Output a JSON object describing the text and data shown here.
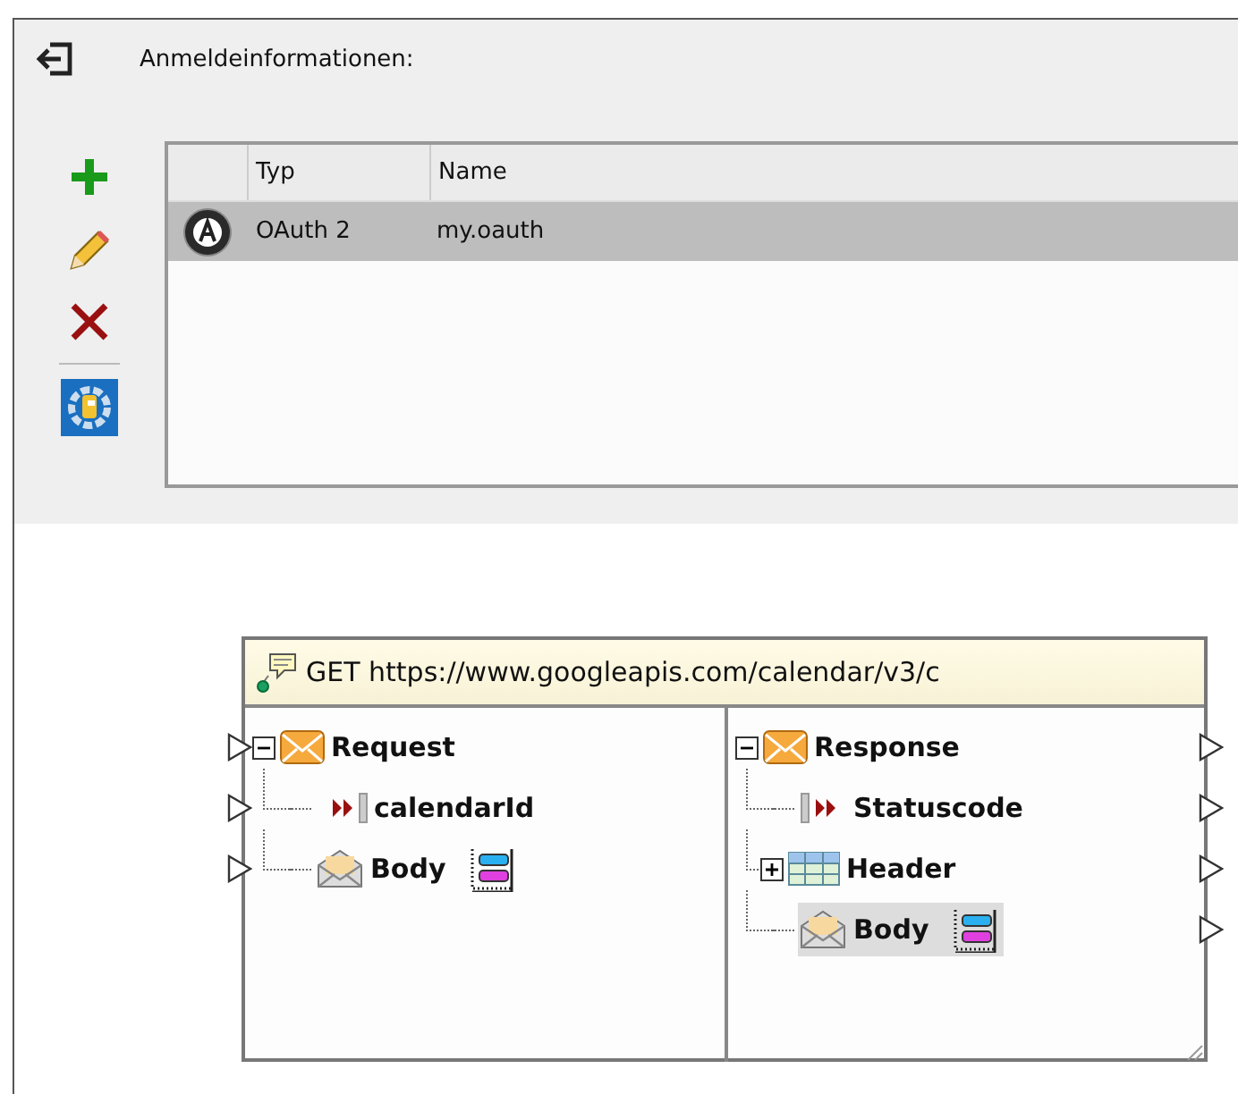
{
  "login": {
    "label": "Anmeldeinformationen:"
  },
  "credentials": {
    "columns": [
      "Typ",
      "Name"
    ],
    "rows": [
      {
        "type": "OAuth 2",
        "name": "my.oauth",
        "selected": true
      }
    ]
  },
  "component": {
    "title": "GET https://www.googleapis.com/calendar/v3/c",
    "request": {
      "label": "Request",
      "kind": "message",
      "expanded": true,
      "children": [
        {
          "label": "calendarId",
          "kind": "parameter",
          "selected": false
        },
        {
          "label": "Body",
          "kind": "body",
          "selected": false
        }
      ]
    },
    "response": {
      "label": "Response",
      "kind": "message",
      "expanded": true,
      "children": [
        {
          "label": "Statuscode",
          "kind": "status",
          "selected": false
        },
        {
          "label": "Header",
          "kind": "header",
          "expanded": false,
          "selected": false
        },
        {
          "label": "Body",
          "kind": "body",
          "selected": true
        }
      ]
    }
  }
}
